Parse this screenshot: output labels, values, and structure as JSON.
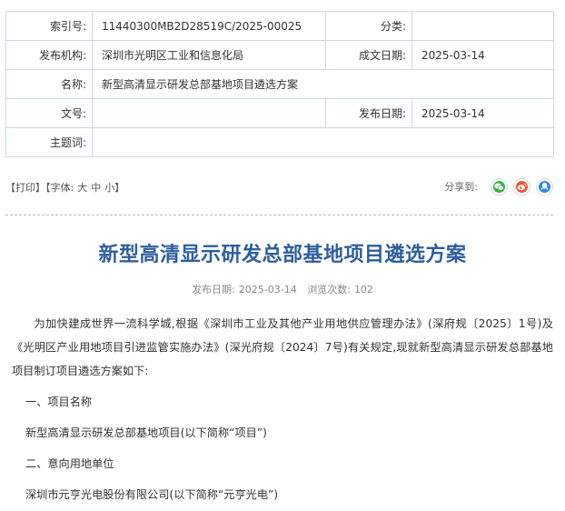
{
  "meta": {
    "index_label": "索引号:",
    "index_value": "11440300MB2D28519C/2025-00025",
    "category_label": "分类:",
    "category_value": "",
    "issuer_label": "发布机构:",
    "issuer_value": "深圳市光明区工业和信息化局",
    "written_date_label": "成文日期:",
    "written_date_value": "2025-03-14",
    "name_label": "名称:",
    "name_value": "新型高清显示研发总部基地项目遴选方案",
    "doc_no_label": "文号:",
    "doc_no_value": "",
    "publish_date_label": "发布日期:",
    "publish_date_value": "2025-03-14",
    "subject_label": "主题词:",
    "subject_value": ""
  },
  "toolbar": {
    "print": "【打印】",
    "font_label": "【字体:",
    "font_large": "大",
    "font_medium": "中",
    "font_small": "小】",
    "share_label": "分享到:",
    "share_colors": {
      "wechat": "#3bb23f",
      "weibo": "#e8563a",
      "qq": "#2e8be6"
    }
  },
  "article": {
    "title": "新型高清显示研发总部基地项目遴选方案",
    "publish_label": "发布日期:",
    "publish_date": "2025-03-14",
    "views_label": "浏览次数:",
    "views": "102",
    "paragraphs": [
      "为加快建成世界一流科学城,根据《深圳市工业及其他产业用地供应管理办法》(深府规〔2025〕1号)及《光明区产业用地项目引进监管实施办法》(深光府规〔2024〕7号)有关规定,现就新型高清显示研发总部基地项目制订项目遴选方案如下:",
      "一、项目名称",
      "新型高清显示研发总部基地项目(以下简称“项目”)",
      "二、意向用地单位",
      "深圳市元亨光电股份有限公司(以下简称“元亨光电”)"
    ]
  }
}
